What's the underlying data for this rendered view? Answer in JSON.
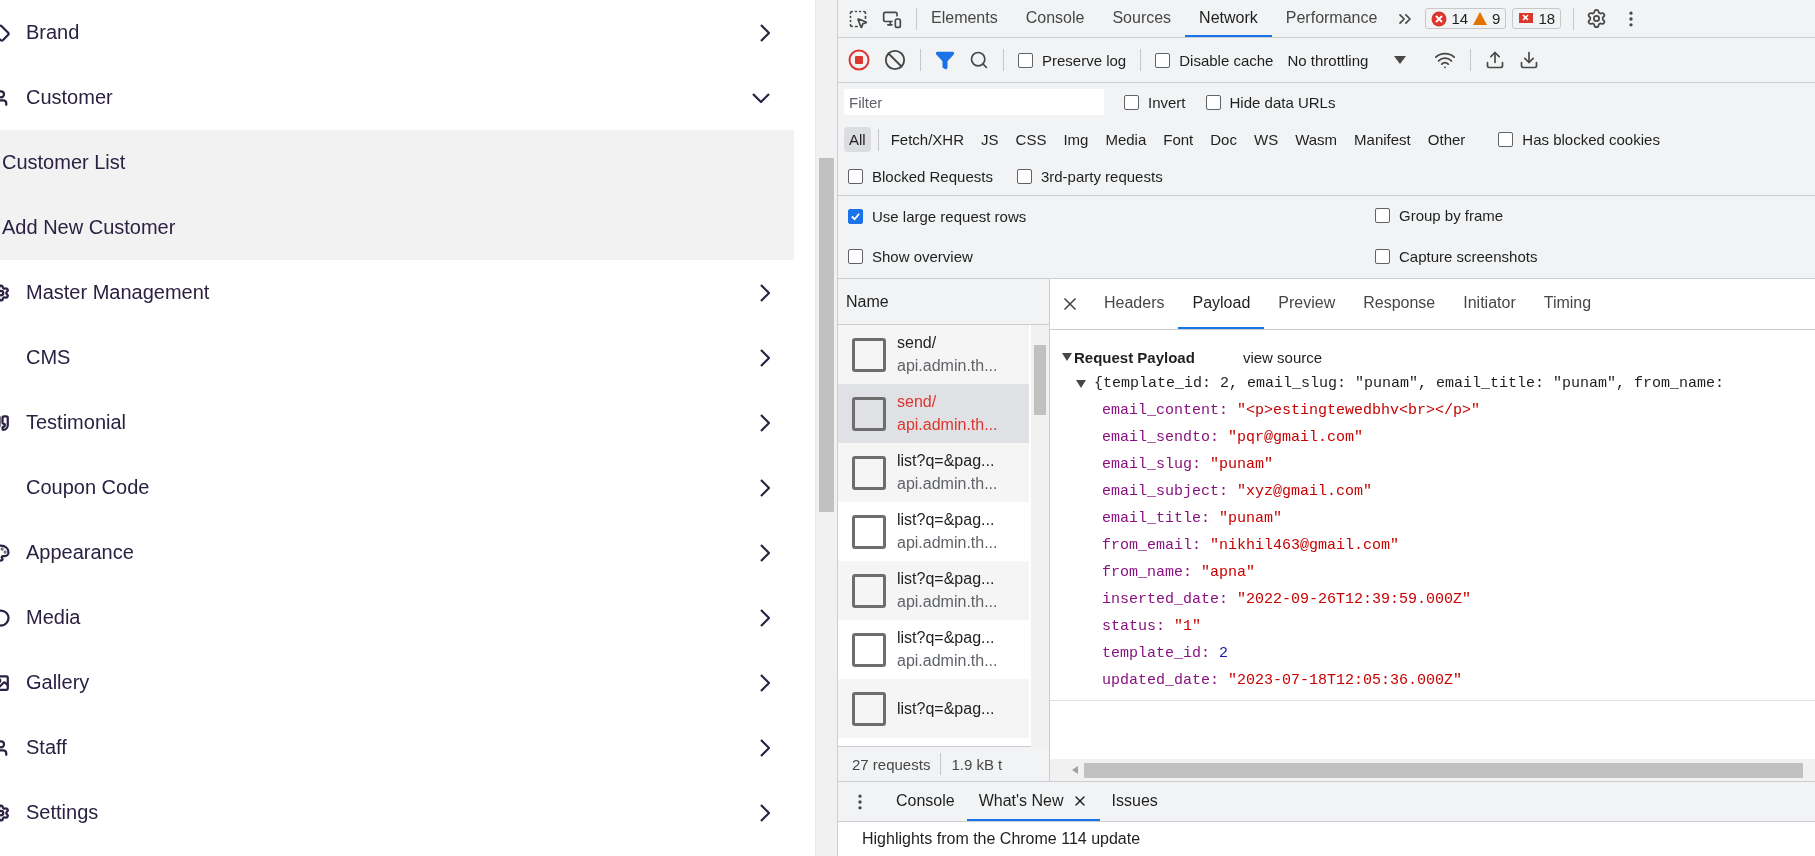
{
  "sidebar": {
    "items": [
      {
        "label": "Brand",
        "expanded": false
      },
      {
        "label": "Customer",
        "expanded": true,
        "children": [
          {
            "label": "Customer List"
          },
          {
            "label": "Add New Customer"
          }
        ]
      },
      {
        "label": "Master Management",
        "expanded": false
      },
      {
        "label": "CMS",
        "expanded": false
      },
      {
        "label": "Testimonial",
        "expanded": false
      },
      {
        "label": "Coupon Code",
        "expanded": false
      },
      {
        "label": "Appearance",
        "expanded": false
      },
      {
        "label": "Media",
        "expanded": false
      },
      {
        "label": "Gallery",
        "expanded": false
      },
      {
        "label": "Staff",
        "expanded": false
      },
      {
        "label": "Settings",
        "expanded": false
      }
    ]
  },
  "devtools": {
    "main_tabs": [
      {
        "label": "Elements",
        "selected": false
      },
      {
        "label": "Console",
        "selected": false
      },
      {
        "label": "Sources",
        "selected": false
      },
      {
        "label": "Network",
        "selected": true
      },
      {
        "label": "Performance",
        "selected": false
      }
    ],
    "counters": {
      "errors": "14",
      "warnings": "9",
      "issues": "18"
    },
    "toolbar": {
      "preserve_log": {
        "label": "Preserve log",
        "checked": false
      },
      "disable_cache": {
        "label": "Disable cache",
        "checked": false
      },
      "throttling": "No throttling"
    },
    "filter": {
      "placeholder": "Filter",
      "invert": {
        "label": "Invert",
        "checked": false
      },
      "hide_data_urls": {
        "label": "Hide data URLs",
        "checked": false
      }
    },
    "type_filters": [
      {
        "label": "All",
        "selected": true
      },
      {
        "label": "Fetch/XHR",
        "selected": false
      },
      {
        "label": "JS",
        "selected": false
      },
      {
        "label": "CSS",
        "selected": false
      },
      {
        "label": "Img",
        "selected": false
      },
      {
        "label": "Media",
        "selected": false
      },
      {
        "label": "Font",
        "selected": false
      },
      {
        "label": "Doc",
        "selected": false
      },
      {
        "label": "WS",
        "selected": false
      },
      {
        "label": "Wasm",
        "selected": false
      },
      {
        "label": "Manifest",
        "selected": false
      },
      {
        "label": "Other",
        "selected": false
      }
    ],
    "has_blocked_cookies": {
      "label": "Has blocked cookies",
      "checked": false
    },
    "blocked_filters": [
      {
        "label": "Blocked Requests",
        "checked": false
      },
      {
        "label": "3rd-party requests",
        "checked": false
      }
    ],
    "settings": [
      {
        "label": "Use large request rows",
        "checked": true
      },
      {
        "label": "Group by frame",
        "checked": false
      },
      {
        "label": "Show overview",
        "checked": false
      },
      {
        "label": "Capture screenshots",
        "checked": false
      }
    ],
    "requests_header": "Name",
    "requests": [
      {
        "name": "send/",
        "domain": "api.admin.th...",
        "selected": false,
        "failed": false
      },
      {
        "name": "send/",
        "domain": "api.admin.th...",
        "selected": true,
        "failed": true
      },
      {
        "name": "list?q=&pag...",
        "domain": "api.admin.th...",
        "selected": false,
        "failed": false
      },
      {
        "name": "list?q=&pag...",
        "domain": "api.admin.th...",
        "selected": false,
        "failed": false
      },
      {
        "name": "list?q=&pag...",
        "domain": "api.admin.th...",
        "selected": false,
        "failed": false
      },
      {
        "name": "list?q=&pag...",
        "domain": "api.admin.th...",
        "selected": false,
        "failed": false
      },
      {
        "name": "list?q=&pag...",
        "selected": false,
        "failed": false
      }
    ],
    "status": {
      "requests": "27 requests",
      "transferred": "1.9 kB t"
    },
    "detail_tabs": [
      {
        "label": "Headers",
        "selected": false
      },
      {
        "label": "Payload",
        "selected": true
      },
      {
        "label": "Preview",
        "selected": false
      },
      {
        "label": "Response",
        "selected": false
      },
      {
        "label": "Initiator",
        "selected": false
      },
      {
        "label": "Timing",
        "selected": false
      }
    ],
    "payload": {
      "title": "Request Payload",
      "view_source": "view source",
      "expanded": true,
      "summary": "{template_id: 2, email_slug: \"punam\", email_title: \"punam\", from_name:",
      "properties": [
        {
          "key": "email_content:",
          "value": "\"<p>estingtewedbhv<br></p>\"",
          "kind": "string"
        },
        {
          "key": "email_sendto:",
          "value": "\"pqr@gmail.com\"",
          "kind": "string"
        },
        {
          "key": "email_slug:",
          "value": "\"punam\"",
          "kind": "string"
        },
        {
          "key": "email_subject:",
          "value": "\"xyz@gmail.com\"",
          "kind": "string"
        },
        {
          "key": "email_title:",
          "value": "\"punam\"",
          "kind": "string"
        },
        {
          "key": "from_email:",
          "value": "\"nikhil463@gmail.com\"",
          "kind": "string"
        },
        {
          "key": "from_name:",
          "value": "\"apna\"",
          "kind": "string"
        },
        {
          "key": "inserted_date:",
          "value": "\"2022-09-26T12:39:59.000Z\"",
          "kind": "string"
        },
        {
          "key": "status:",
          "value": "\"1\"",
          "kind": "string"
        },
        {
          "key": "template_id:",
          "value": "2",
          "kind": "number"
        },
        {
          "key": "updated_date:",
          "value": "\"2023-07-18T12:05:36.000Z\"",
          "kind": "string"
        }
      ]
    },
    "drawer_tabs": [
      {
        "label": "Console",
        "selected": false,
        "closable": false
      },
      {
        "label": "What's New",
        "selected": true,
        "closable": true
      },
      {
        "label": "Issues",
        "selected": false,
        "closable": false
      }
    ],
    "drawer_text": "Highlights from the Chrome 114 update"
  }
}
